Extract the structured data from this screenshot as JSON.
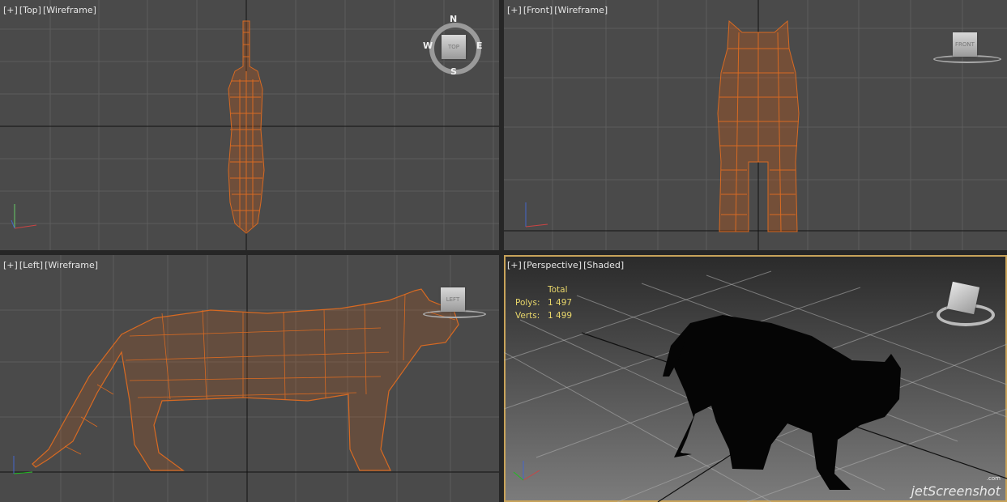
{
  "viewports": {
    "top": {
      "plus": "[+]",
      "view": "[Top]",
      "mode": "[Wireframe]"
    },
    "front": {
      "plus": "[+]",
      "view": "[Front]",
      "mode": "[Wireframe]"
    },
    "left": {
      "plus": "[+]",
      "view": "[Left]",
      "mode": "[Wireframe]"
    },
    "perspective": {
      "plus": "[+]",
      "view": "[Perspective]",
      "mode": "[Shaded]"
    }
  },
  "stats": {
    "header": "Total",
    "polys_label": "Polys:",
    "polys": "1 497",
    "verts_label": "Verts:",
    "verts": "1 499"
  },
  "viewcube": {
    "top": "TOP",
    "front": "FRONT",
    "left": "LEFT",
    "n": "N",
    "s": "S",
    "e": "E",
    "w": "W"
  },
  "axes": {
    "x": "x",
    "y": "y",
    "z": "z"
  },
  "watermark": {
    "brand": "jetScreenshot",
    "suffix": ".com"
  },
  "colors": {
    "wire": "#d86a22",
    "grid": "#5f5f5f",
    "axis_line": "#111111",
    "active_border": "#c8a35a",
    "stats_text": "#e8d66a"
  }
}
